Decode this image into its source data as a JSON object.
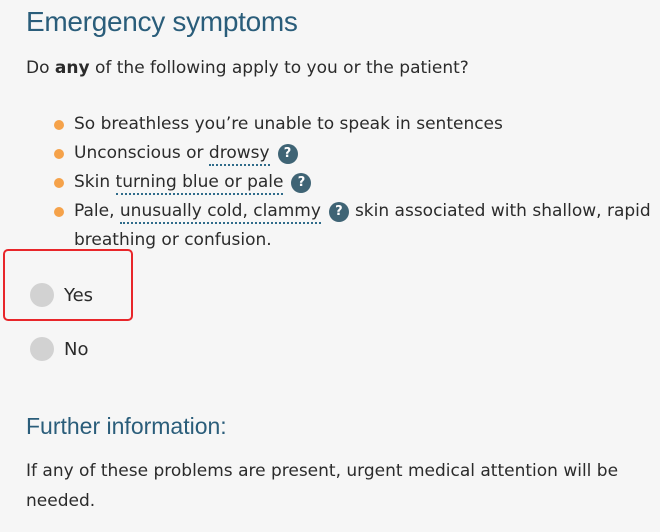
{
  "title": "Emergency symptoms",
  "question": {
    "prefix": "Do ",
    "emphasis": "any",
    "suffix": " of the following apply to you or the patient?"
  },
  "symptoms": [
    {
      "text": "So breathless you’re unable to speak in sentences"
    },
    {
      "before": "Unconscious or ",
      "term": "drowsy"
    },
    {
      "before": "Skin ",
      "term": "turning blue or pale"
    },
    {
      "before": "Pale, ",
      "term": "unusually cold, clammy",
      "after": "skin associated with shallow, rapid breathing or confusion."
    }
  ],
  "help_icon": "?",
  "icons": {
    "bullet": "orange-dot",
    "help": "question-mark-circle-icon",
    "bullet_color": "#f5a24a",
    "help_color": "#3f6475",
    "heading_color": "#2a5d7a",
    "highlight_color": "#e8262a"
  },
  "options": [
    {
      "label": "Yes",
      "selected": false
    },
    {
      "label": "No",
      "selected": false
    }
  ],
  "further": {
    "heading": "Further information:",
    "text": "If any of these problems are present, urgent medical attention will be needed."
  }
}
